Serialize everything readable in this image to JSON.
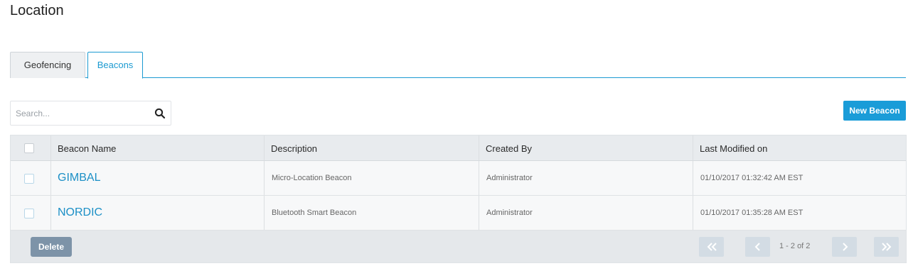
{
  "page": {
    "title": "Location"
  },
  "tabs": [
    {
      "label": "Geofencing",
      "active": false
    },
    {
      "label": "Beacons",
      "active": true
    }
  ],
  "search": {
    "placeholder": "Search...",
    "value": "",
    "icon": "search-icon"
  },
  "toolbar": {
    "new_label": "New Beacon"
  },
  "table": {
    "columns": [
      "Beacon Name",
      "Description",
      "Created By",
      "Last Modified on"
    ],
    "rows": [
      {
        "name": "GIMBAL",
        "description": "Micro-Location Beacon",
        "created_by": "Administrator",
        "modified": "01/10/2017 01:32:42 AM EST"
      },
      {
        "name": "NORDIC",
        "description": "Bluetooth Smart Beacon",
        "created_by": "Administrator",
        "modified": "01/10/2017 01:35:28 AM EST"
      }
    ]
  },
  "footer": {
    "delete_label": "Delete",
    "pagination": "1 - 2 of 2"
  },
  "colors": {
    "accent": "#1a9cd8",
    "delete": "#7d93a8",
    "link": "#1b8fc6"
  }
}
